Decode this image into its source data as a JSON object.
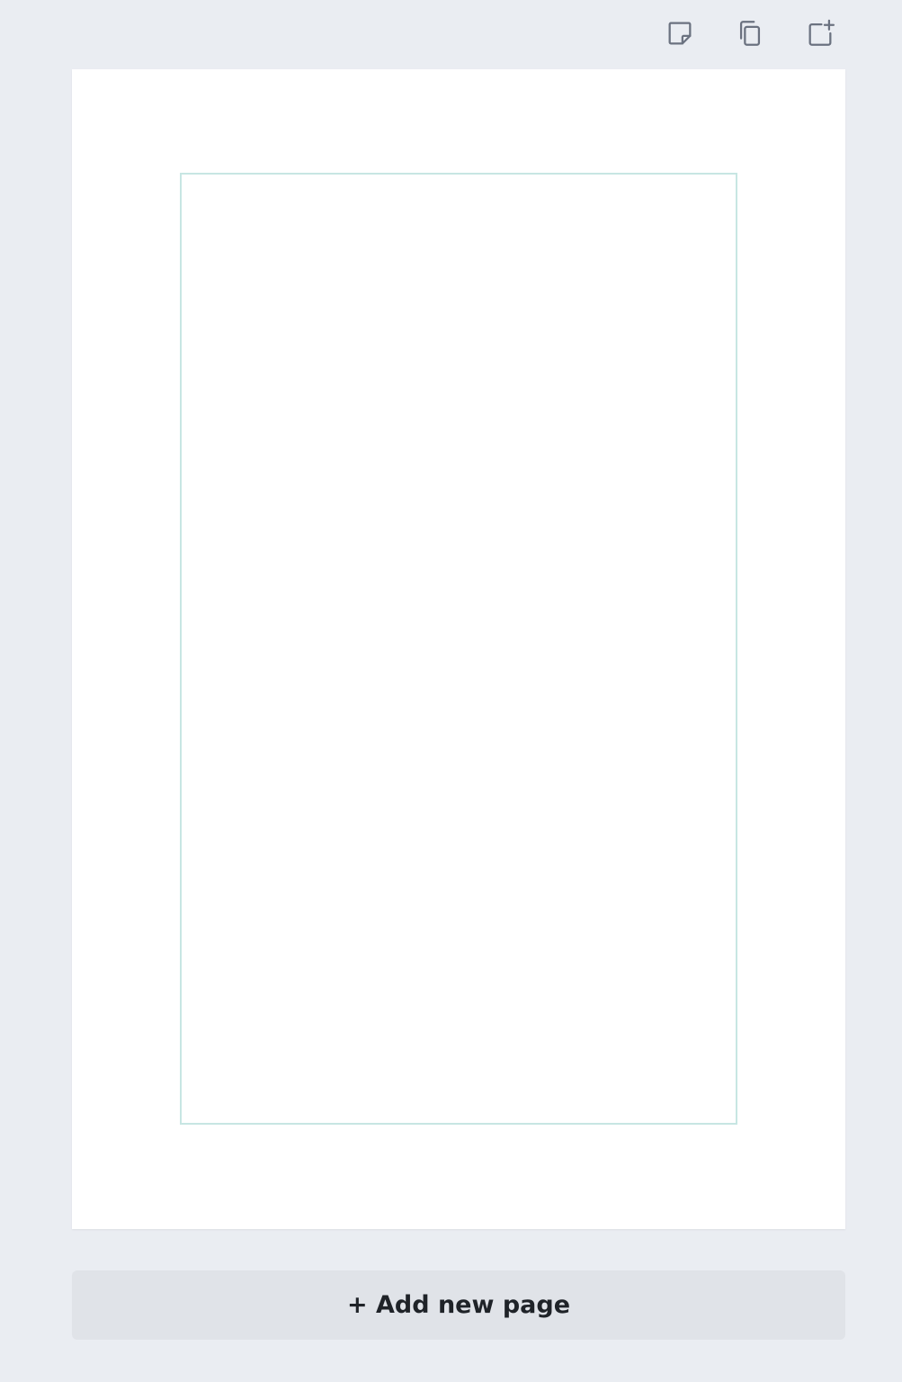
{
  "toolbar": {
    "icons": [
      {
        "name": "add-notes-icon"
      },
      {
        "name": "duplicate-page-icon"
      },
      {
        "name": "add-page-icon"
      }
    ]
  },
  "page": {
    "background": "#ffffff",
    "guide_color": "#c7e6e3"
  },
  "actions": {
    "add_page_label": "+ Add new page"
  },
  "colors": {
    "app_background": "#eaedf2",
    "button_background": "#e0e3e8",
    "icon_stroke": "#6b7280"
  }
}
